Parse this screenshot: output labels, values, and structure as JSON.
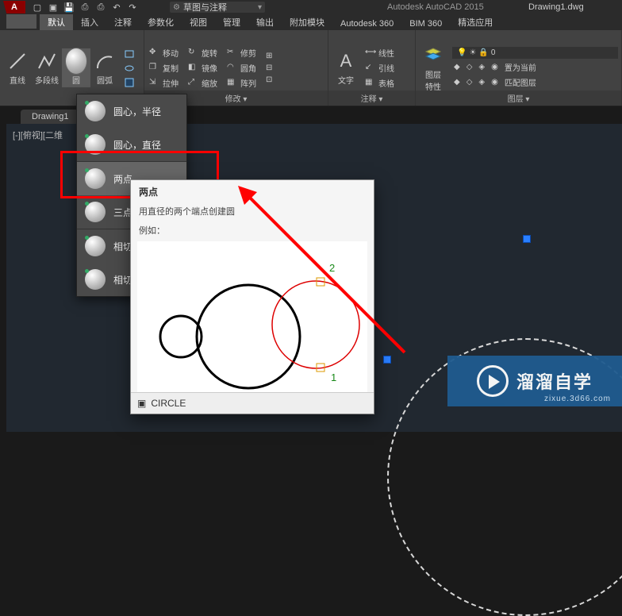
{
  "app": {
    "title": "Autodesk AutoCAD 2015",
    "doc": "Drawing1.dwg",
    "logo": "A"
  },
  "qat": {
    "search_placeholder": "草图与注释"
  },
  "tabs": [
    "默认",
    "插入",
    "注释",
    "参数化",
    "视图",
    "管理",
    "输出",
    "附加模块",
    "Autodesk 360",
    "BIM 360",
    "精选应用"
  ],
  "ribbon": {
    "draw": {
      "line": "直线",
      "pline": "多段线",
      "circle": "圆",
      "arc": "圆弧"
    },
    "modify": {
      "title": "修改 ▾",
      "move": "移动",
      "rotate": "旋转",
      "trim": "修剪",
      "copy": "复制",
      "mirror": "镜像",
      "fillet": "圆角",
      "stretch": "拉伸",
      "scale": "缩放",
      "array": "阵列"
    },
    "annotate": {
      "title": "注释 ▾",
      "text": "文字",
      "linear": "线性",
      "leader": "引线",
      "table": "表格"
    },
    "layer": {
      "title": "图层 ▾",
      "props": "图层\n特性",
      "zero": "0",
      "match": "置为当前",
      "matchlayer": "匹配图层"
    }
  },
  "doc_tab": "Drawing1",
  "view_label": "[-][俯视][二维",
  "menu": {
    "items": [
      {
        "label": "圆心，半径"
      },
      {
        "label": "圆心，直径"
      },
      {
        "label": "两点"
      },
      {
        "label": "三点"
      },
      {
        "label": "相切，"
      },
      {
        "label": "相切，"
      }
    ]
  },
  "tooltip": {
    "title": "两点",
    "desc": "用直径的两个端点创建圆",
    "example": "例如：",
    "pt1": "1",
    "pt2": "2",
    "cmd": "CIRCLE"
  },
  "watermark": {
    "text": "溜溜自学",
    "sub": "zixue.3d66.com"
  }
}
